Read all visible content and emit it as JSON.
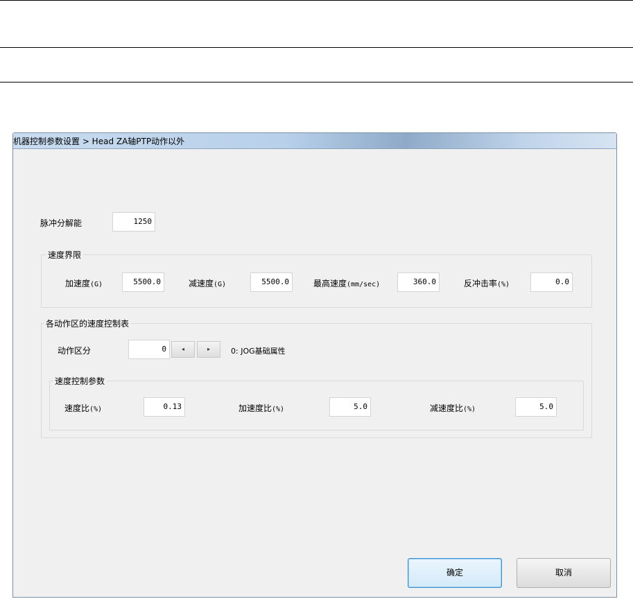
{
  "window": {
    "title": "机器控制参数设置 > Head ZA轴PTP动作以外"
  },
  "pulse": {
    "label": "脉冲分解能",
    "value": "1250"
  },
  "speed_limit": {
    "title": "速度界限",
    "accel": {
      "label": "加速度",
      "unit": "(G)",
      "value": "5500.0"
    },
    "decel": {
      "label": "减速度",
      "unit": "(G)",
      "value": "5500.0"
    },
    "max_speed": {
      "label": "最高速度",
      "unit": "(mm/sec)",
      "value": "360.0"
    },
    "rebound": {
      "label": "反冲击率",
      "unit": "(%)",
      "value": "0.0"
    }
  },
  "section_table": {
    "title": "各动作区的速度控制表",
    "zone_label": "动作区分",
    "zone_value": "0",
    "prev_glyph": "◂",
    "next_glyph": "▸",
    "zone_desc": "0: JOG基础属性",
    "params": {
      "title": "速度控制参数",
      "speed_ratio": {
        "label": "速度比",
        "unit": "(%)",
        "value": "0.13"
      },
      "accel_ratio": {
        "label": "加速度比",
        "unit": "(%)",
        "value": "5.0"
      },
      "decel_ratio": {
        "label": "减速度比",
        "unit": "(%)",
        "value": "5.0"
      }
    }
  },
  "buttons": {
    "ok": "确定",
    "cancel": "取消"
  }
}
